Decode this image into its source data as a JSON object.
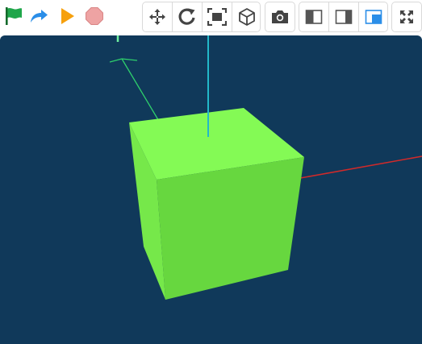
{
  "toolbar": {
    "run_controls": [
      {
        "name": "green-flag-icon",
        "color": "#1fa64a"
      },
      {
        "name": "redo-icon",
        "color": "#2b8ee8"
      },
      {
        "name": "play-icon",
        "color": "#f6a00d"
      },
      {
        "name": "stop-icon",
        "color": "#eea3a3"
      }
    ],
    "view_tools": [
      "move-arrows-icon",
      "rotate-icon",
      "fit-frame-icon",
      "cube-view-icon"
    ],
    "camera": "camera-icon",
    "layout_tools": [
      "layout-left-panel-icon",
      "layout-right-panel-icon",
      "layout-inset-icon"
    ],
    "layout_selected": "layout-inset-icon",
    "fullscreen": "fullscreen-icon",
    "accent_color": "#2b8ee8"
  },
  "scene": {
    "background": "#10395a",
    "cube_colors": {
      "top": "#84fa55",
      "front": "#67d73f",
      "side": "#5fca3a"
    },
    "axes": {
      "x_color": "#d12a2a",
      "y_color": "#23b8c9",
      "z_color": "#2ecf6c"
    }
  }
}
